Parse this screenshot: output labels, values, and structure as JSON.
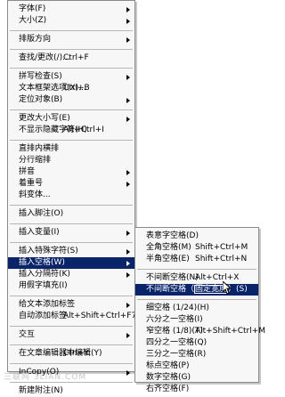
{
  "main_menu": {
    "groups": [
      [
        {
          "label": "字体(F)",
          "submenu": true
        },
        {
          "label": "大小(Z)",
          "submenu": true
        }
      ],
      [
        {
          "label": "排版方向",
          "submenu": true
        }
      ],
      [
        {
          "label": "查找/更改(/)...",
          "shortcut": "Ctrl+F"
        }
      ],
      [
        {
          "label": "拼写检查(S)",
          "submenu": true
        },
        {
          "label": "文本框架选项(X)...",
          "shortcut": "Ctrl+B"
        },
        {
          "label": "定位对象(B)",
          "submenu": true
        }
      ],
      [
        {
          "label": "更改大小写(E)",
          "submenu": true
        },
        {
          "label": "不显示隐藏字符(H)",
          "shortcut": "Alt+Ctrl+I"
        }
      ],
      [
        {
          "label": "直排内横排"
        },
        {
          "label": "分行缩排"
        },
        {
          "label": "拼音",
          "submenu": true
        },
        {
          "label": "着重号",
          "submenu": true
        },
        {
          "label": "斜变体..."
        }
      ],
      [
        {
          "label": "插入脚注(O)"
        }
      ],
      [
        {
          "label": "插入变量(I)",
          "submenu": true
        }
      ],
      [
        {
          "label": "插入特殊字符(S)",
          "submenu": true
        },
        {
          "label": "插入空格(W)",
          "submenu": true,
          "highlighted": true
        },
        {
          "label": "插入分隔符(K)",
          "submenu": true
        },
        {
          "label": "用假字填充(I)"
        }
      ],
      [
        {
          "label": "给文本添加标签",
          "submenu": true
        },
        {
          "label": "自动添加标签",
          "shortcut": "Alt+Shift+Ctrl+F7"
        }
      ],
      [
        {
          "label": "交互",
          "submenu": true
        }
      ],
      [
        {
          "label": "在文章编辑器中编辑(Y)",
          "shortcut": "Ctrl+Y"
        }
      ],
      [
        {
          "label": "InCopy(O)",
          "submenu": true
        }
      ],
      [
        {
          "label": "新建附注(N)"
        }
      ]
    ]
  },
  "sub_menu": {
    "groups": [
      [
        {
          "label": "表意字空格(D)"
        },
        {
          "label": "全角空格(M)",
          "shortcut": "Shift+Ctrl+M"
        },
        {
          "label": "半角空格(E)",
          "shortcut": "Shift+Ctrl+N"
        }
      ],
      [
        {
          "label": "不间断空格(N)",
          "shortcut": "Alt+Ctrl+X"
        },
        {
          "label_pre": "不间断空格（",
          "label_boxed": "固定宽度",
          "label_post": "）(S)",
          "highlighted": true
        }
      ],
      [
        {
          "label": "细空格 (1/24)(H)"
        },
        {
          "label": "六分之一空格(I)"
        },
        {
          "label": "窄空格 (1/8)(T)",
          "shortcut": "Alt+Shift+Ctrl+M"
        },
        {
          "label": "四分之一空格(Q)"
        },
        {
          "label": "三分之一空格(R)"
        },
        {
          "label": "标点空格(P)"
        },
        {
          "label": "数字空格(G)"
        },
        {
          "label": "右齐空格(F)"
        }
      ]
    ]
  },
  "watermark": "三联网 3LIAN.COM",
  "cursor_icon": "mouse-pointer-icon"
}
